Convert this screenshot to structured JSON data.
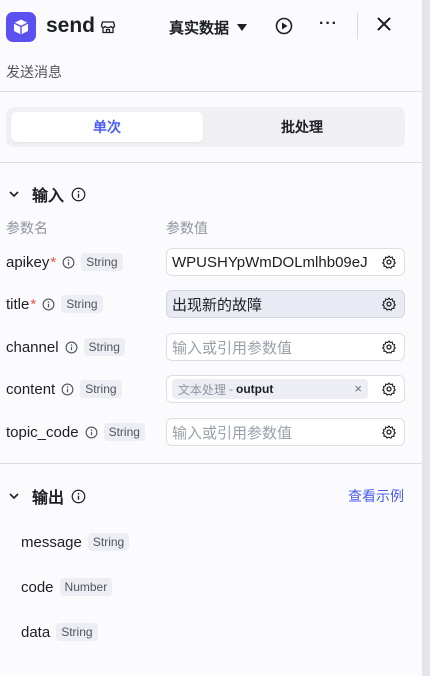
{
  "header": {
    "title": "send",
    "mode": "真实数据",
    "description": "发送消息"
  },
  "tabs": [
    {
      "label": "单次",
      "active": true
    },
    {
      "label": "批处理",
      "active": false
    }
  ],
  "inputs": {
    "title": "输入",
    "col_name": "参数名",
    "col_value": "参数值",
    "params": [
      {
        "name": "apikey",
        "required": true,
        "type": "String",
        "value": "WPUSHYpWmDOLmlhb09eJ",
        "placeholder": ""
      },
      {
        "name": "title",
        "required": true,
        "type": "String",
        "value": "出现新的故障",
        "placeholder": ""
      },
      {
        "name": "channel",
        "required": false,
        "type": "String",
        "value": "",
        "placeholder": "输入或引用参数值"
      },
      {
        "name": "content",
        "required": false,
        "type": "String",
        "value": "",
        "placeholder": "",
        "ref_source": "文本处理",
        "ref_sep": "-",
        "ref_var": "output"
      },
      {
        "name": "topic_code",
        "required": false,
        "type": "String",
        "value": "",
        "placeholder": "输入或引用参数值"
      }
    ]
  },
  "outputs": {
    "title": "输出",
    "link": "查看示例",
    "fields": [
      {
        "name": "message",
        "type": "String"
      },
      {
        "name": "code",
        "type": "Number"
      },
      {
        "name": "data",
        "type": "String"
      }
    ]
  },
  "colors": {
    "accent": "#4b5cf0",
    "logo_bg": "#5b50f0",
    "required": "#f04d4d"
  }
}
